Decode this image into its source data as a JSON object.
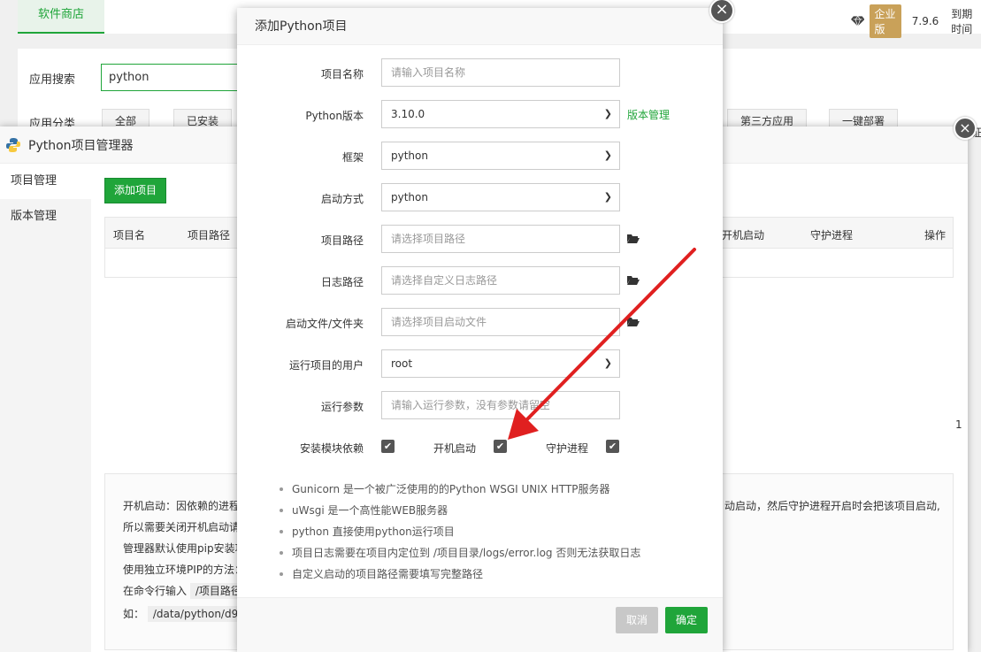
{
  "base": {
    "store_tab": "软件商店",
    "edition": "企业版",
    "version": "7.9.6",
    "expire": "到期时间",
    "search_label": "应用搜索",
    "search_value": "python",
    "category_label": "应用分类",
    "categories": [
      "全部",
      "已安装",
      "第三方应用",
      "一键部署"
    ]
  },
  "manager": {
    "title": "Python项目管理器",
    "close": "×",
    "side": [
      "项目管理",
      "版本管理"
    ],
    "add_button": "添加项目",
    "columns": [
      "项目名",
      "项目路径",
      "开机启动",
      "守护进程",
      "操作"
    ],
    "help_left": [
      "开机启动：因依赖的进程",
      "所以需要关闭开机启动请",
      "管理器默认使用pip安装项",
      "使用独立环境PIP的方法：",
      "在命令行输入",
      "如："
    ],
    "help_code": [
      "/项目路径",
      "/data/python/d9"
    ],
    "help_right": "动启动，然后守护进程开启时会把该项目启动,",
    "right_frag": "证",
    "right_frag2": "1"
  },
  "dialog": {
    "title": "添加Python项目",
    "close": "×",
    "fields": {
      "name": {
        "label": "项目名称",
        "placeholder": "请输入项目名称"
      },
      "pyver": {
        "label": "Python版本",
        "value": "3.10.0",
        "link": "版本管理"
      },
      "framework": {
        "label": "框架",
        "value": "python"
      },
      "startup": {
        "label": "启动方式",
        "value": "python"
      },
      "path": {
        "label": "项目路径",
        "placeholder": "请选择项目路径"
      },
      "logpath": {
        "label": "日志路径",
        "placeholder": "请选择自定义日志路径"
      },
      "startfile": {
        "label": "启动文件/文件夹",
        "placeholder": "请选择项目启动文件"
      },
      "user": {
        "label": "运行项目的用户",
        "value": "root"
      },
      "args": {
        "label": "运行参数",
        "placeholder": "请输入运行参数，没有参数请留空"
      }
    },
    "checkboxes": [
      "安装模块依赖",
      "开机启动",
      "守护进程"
    ],
    "tips": [
      "Gunicorn 是一个被广泛使用的的Python WSGI UNIX HTTP服务器",
      "uWsgi 是一个高性能WEB服务器",
      "python 直接使用python运行项目",
      "项目日志需要在项目内定位到 /项目目录/logs/error.log 否则无法获取日志",
      "自定义启动的项目路径需要填写完整路径"
    ],
    "cancel": "取消",
    "confirm": "确定"
  },
  "colors": {
    "accent": "#20a53a",
    "arrow": "#e02020"
  },
  "icons": {
    "check": "✔",
    "folder": "folder-icon",
    "chevron": "chevron-down-icon"
  }
}
